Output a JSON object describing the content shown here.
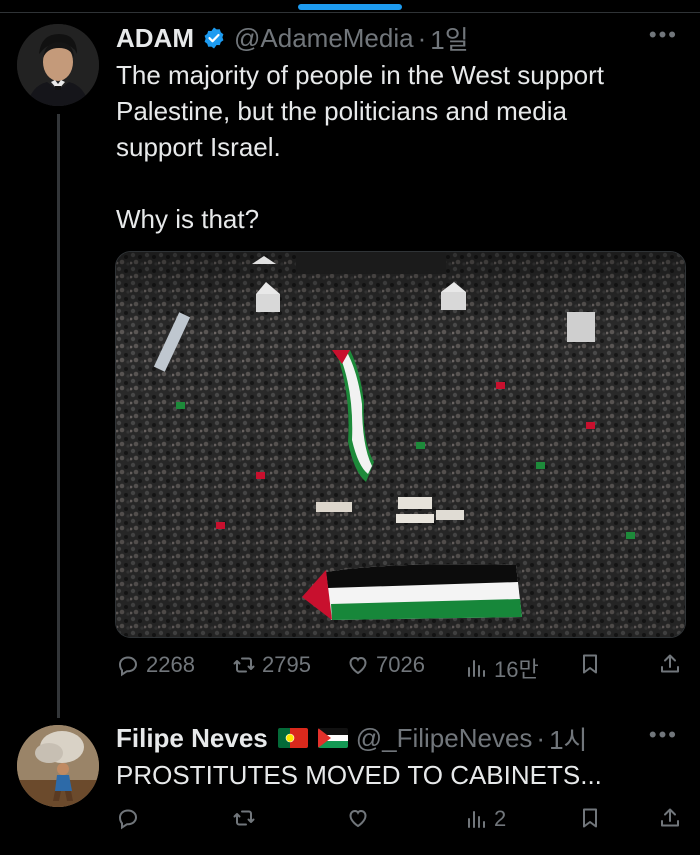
{
  "tweet": {
    "name": "ADAM",
    "handle": "@AdameMedia",
    "separator": "·",
    "time": "1일",
    "text": "The majority of people in the West support\nPalestine, but the politicians and media\nsupport Israel.\n\nWhy is that?",
    "stats": {
      "replies": "2268",
      "retweets": "2795",
      "likes": "7026",
      "views": "16만"
    }
  },
  "reply": {
    "name": "Filipe Neves",
    "handle": "@_FilipeNeves",
    "separator": "·",
    "time": "1시",
    "text": "PROSTITUTES MOVED TO CABINETS...",
    "stats": {
      "views": "2"
    }
  },
  "colors": {
    "background": "#000000",
    "text": "#e7e9ea",
    "muted": "#71767b",
    "accent": "#1d9bf0"
  },
  "icons": [
    "more-icon",
    "verified-icon",
    "reply-icon",
    "retweet-icon",
    "like-icon",
    "views-icon",
    "bookmark-icon",
    "share-icon"
  ]
}
